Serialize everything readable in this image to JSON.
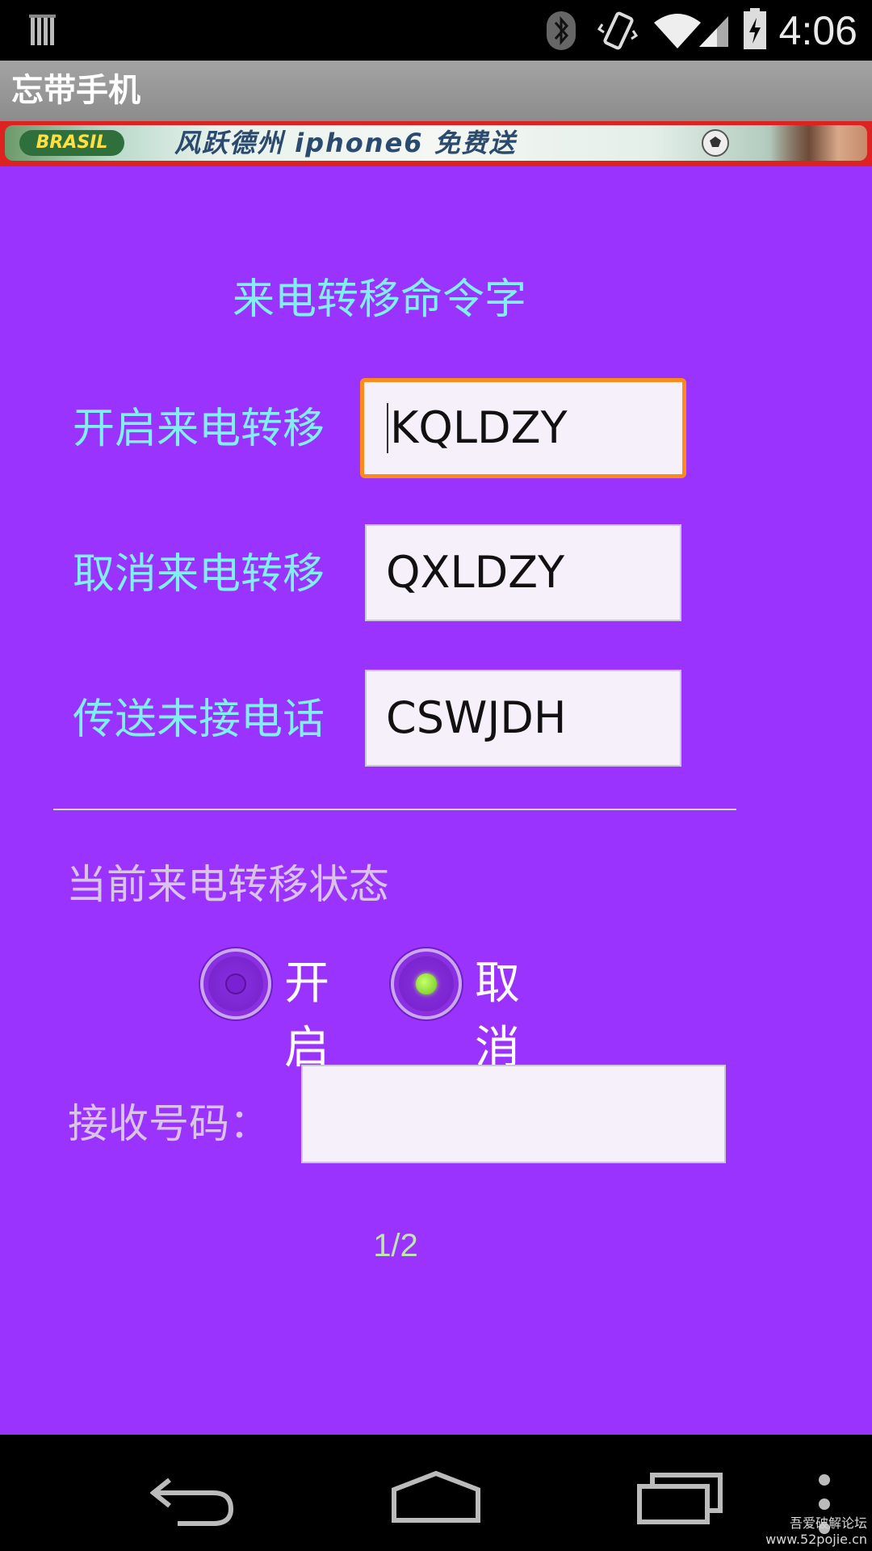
{
  "status_bar": {
    "time": "4:06",
    "icons": [
      "notification-icon",
      "bluetooth-icon",
      "vibrate-icon",
      "wifi-icon",
      "signal-icon",
      "battery-icon"
    ]
  },
  "app": {
    "title": "忘带手机"
  },
  "ad": {
    "badge": "BRASIL",
    "text": "风跃德州 iphone6 免费送"
  },
  "form": {
    "section_title": "来电转移命令字",
    "commands": [
      {
        "label": "开启来电转移",
        "value": "KQLDZY",
        "focused": true
      },
      {
        "label": "取消来电转移",
        "value": "QXLDZY",
        "focused": false
      },
      {
        "label": "传送未接电话",
        "value": "CSWJDH",
        "focused": false
      }
    ],
    "status_label": "当前来电转移状态",
    "options": [
      {
        "label": "开启",
        "checked": false
      },
      {
        "label": "取消",
        "checked": true
      }
    ],
    "receive_label": "接收号码：",
    "receive_value": ""
  },
  "page_indicator": "1/2",
  "nav": {
    "icons": [
      "back-icon",
      "home-icon",
      "recent-apps-icon",
      "menu-icon"
    ]
  },
  "watermark": {
    "line1": "吾爱破解论坛",
    "line2": "www.52pojie.cn"
  },
  "colors": {
    "background": "#9b33ff",
    "accent_text": "#7ff0ee",
    "muted_text": "#d9c4e6",
    "focus_border": "#ff8a1c",
    "radio_checked": "#8be028"
  }
}
